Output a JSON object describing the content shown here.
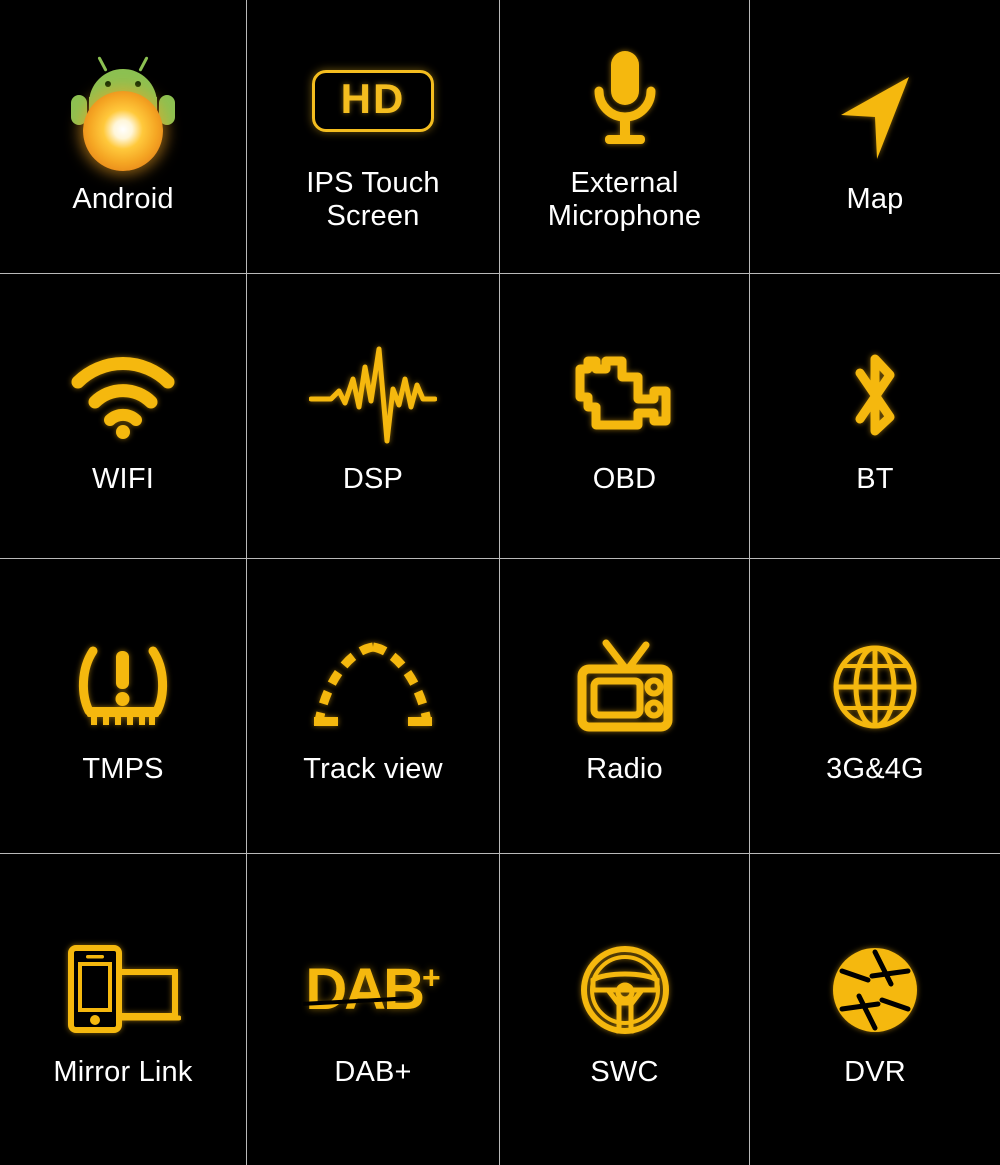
{
  "page": {
    "title": "Car Head Unit Feature Grid",
    "background_color": "#000000",
    "accent_color": "#f5b80e",
    "label_color": "#ffffff",
    "grid_line_color": "#b9b9b9",
    "columns": 4,
    "rows": 4
  },
  "features": [
    {
      "id": "android",
      "label": "Android",
      "icon": "android-oreo-icon",
      "icon_color": "#8cc152"
    },
    {
      "id": "ips-touch",
      "label": "IPS Touch\nScreen",
      "icon": "hd-badge-icon",
      "icon_color": "#f4bd1f",
      "badge_text": "HD"
    },
    {
      "id": "ext-mic",
      "label": "External\nMicrophone",
      "icon": "microphone-icon",
      "icon_color": "#f5b80e"
    },
    {
      "id": "map",
      "label": "Map",
      "icon": "navigation-arrow-icon",
      "icon_color": "#f5b80e"
    },
    {
      "id": "wifi",
      "label": "WIFI",
      "icon": "wifi-icon",
      "icon_color": "#f5b80e"
    },
    {
      "id": "dsp",
      "label": "DSP",
      "icon": "audio-waveform-icon",
      "icon_color": "#f5b80e"
    },
    {
      "id": "obd",
      "label": "OBD",
      "icon": "check-engine-icon",
      "icon_color": "#f5b80e"
    },
    {
      "id": "bt",
      "label": "BT",
      "icon": "bluetooth-icon",
      "icon_color": "#f5b80e"
    },
    {
      "id": "tmps",
      "label": "TMPS",
      "icon": "tire-pressure-icon",
      "icon_color": "#f5b80e"
    },
    {
      "id": "track-view",
      "label": "Track view",
      "icon": "parking-guide-lines-icon",
      "icon_color": "#f5b80e"
    },
    {
      "id": "radio",
      "label": "Radio",
      "icon": "tv-radio-icon",
      "icon_color": "#f5b80e"
    },
    {
      "id": "3g4g",
      "label": "3G&4G",
      "icon": "globe-icon",
      "icon_color": "#f5b80e"
    },
    {
      "id": "mirror-link",
      "label": "Mirror Link",
      "icon": "phone-screen-mirror-icon",
      "icon_color": "#f5b80e"
    },
    {
      "id": "dab-plus",
      "label": "DAB+",
      "icon": "dab-plus-wordmark-icon",
      "icon_color": "#f5b80e",
      "badge_text": "DAB",
      "badge_suffix": "+"
    },
    {
      "id": "swc",
      "label": "SWC",
      "icon": "steering-wheel-icon",
      "icon_color": "#f5b80e"
    },
    {
      "id": "dvr",
      "label": "DVR",
      "icon": "camera-shutter-icon",
      "icon_color": "#f5b80e"
    }
  ]
}
